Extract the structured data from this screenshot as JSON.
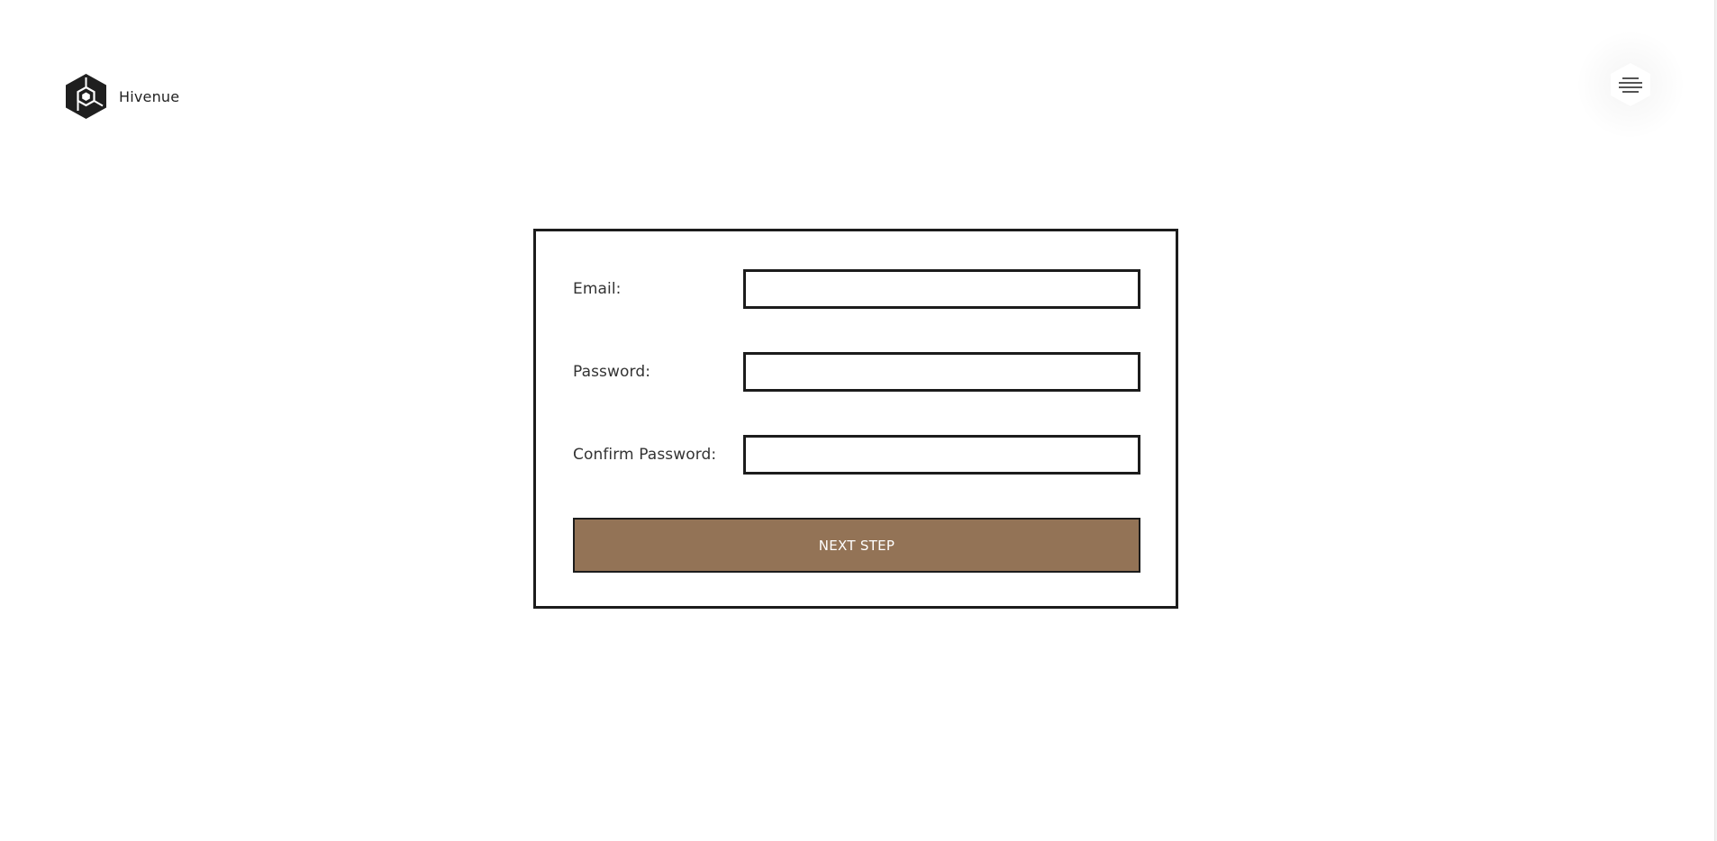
{
  "header": {
    "brand_name": "Hivenue",
    "logo_icon": "hexagon-cube-logo-icon",
    "menu_icon": "hamburger-menu-icon"
  },
  "form": {
    "email": {
      "label": "Email:",
      "value": "",
      "placeholder": ""
    },
    "password": {
      "label": "Password:",
      "value": "",
      "placeholder": ""
    },
    "confirm_password": {
      "label": "Confirm Password:",
      "value": "",
      "placeholder": ""
    },
    "submit_label": "NEXT STEP"
  },
  "colors": {
    "button_background": "#937356",
    "border": "#1c1c1c",
    "background": "#ffffff"
  }
}
